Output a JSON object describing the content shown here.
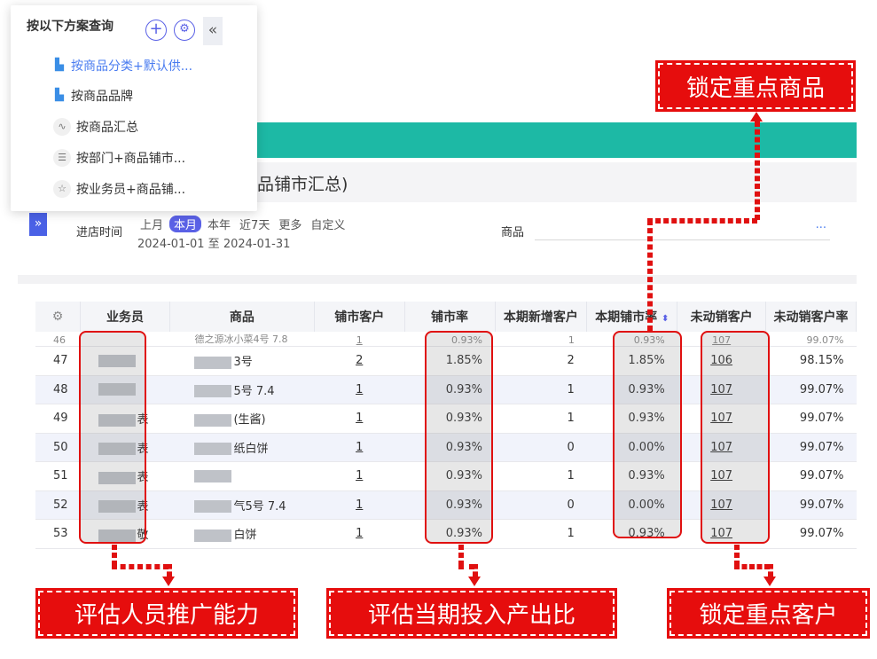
{
  "scheme_panel": {
    "header": "按以下方案查询",
    "items": [
      {
        "label": "按商品分类+默认供...",
        "icon": "bar-chart-icon",
        "active": true
      },
      {
        "label": "按商品品牌",
        "icon": "bar-chart-icon",
        "active": false
      },
      {
        "label": "按商品汇总",
        "icon": "trend-chart-icon",
        "active": false
      },
      {
        "label": "按部门+商品铺市...",
        "icon": "list-icon",
        "active": false
      },
      {
        "label": "按业务员+商品铺...",
        "icon": "star-icon",
        "active": false
      }
    ]
  },
  "page_title_fragment": "品铺市汇总)",
  "filter": {
    "label": "进店时间",
    "periods": [
      "上月",
      "本月",
      "本年",
      "近7天",
      "更多",
      "自定义"
    ],
    "active_period": "本月",
    "date_range": "2024-01-01 至 2024-01-31",
    "goods_label": "商品",
    "goods_more": "..."
  },
  "table": {
    "headers": [
      "业务员",
      "商品",
      "铺市客户",
      "铺市率",
      "本期新增客户",
      "本期铺市率",
      "未动销客户",
      "未动销客户率"
    ],
    "partial_row": {
      "seq": "46",
      "goods": "德之源冰小菜4号 7.8",
      "coverage_customers": "1",
      "coverage_rate": "0.93%",
      "new_customers": "1",
      "period_rate": "0.93%",
      "unsold_customers": "107",
      "unsold_rate": "99.07%"
    },
    "rows": [
      {
        "seq": "47",
        "staff": "",
        "goods": "3号",
        "coverage_customers": "2",
        "coverage_rate": "1.85%",
        "new_customers": "2",
        "period_rate": "1.85%",
        "unsold_customers": "106",
        "unsold_rate": "98.15%"
      },
      {
        "seq": "48",
        "staff": "",
        "goods": "5号 7.4",
        "coverage_customers": "1",
        "coverage_rate": "0.93%",
        "new_customers": "1",
        "period_rate": "0.93%",
        "unsold_customers": "107",
        "unsold_rate": "99.07%"
      },
      {
        "seq": "49",
        "staff": "表",
        "goods": "(生酱)",
        "coverage_customers": "1",
        "coverage_rate": "0.93%",
        "new_customers": "1",
        "period_rate": "0.93%",
        "unsold_customers": "107",
        "unsold_rate": "99.07%"
      },
      {
        "seq": "50",
        "staff": "表",
        "goods": "纸白饼",
        "coverage_customers": "1",
        "coverage_rate": "0.93%",
        "new_customers": "0",
        "period_rate": "0.00%",
        "unsold_customers": "107",
        "unsold_rate": "99.07%"
      },
      {
        "seq": "51",
        "staff": "表",
        "goods": "",
        "coverage_customers": "1",
        "coverage_rate": "0.93%",
        "new_customers": "1",
        "period_rate": "0.93%",
        "unsold_customers": "107",
        "unsold_rate": "99.07%"
      },
      {
        "seq": "52",
        "staff": "表",
        "goods": "气5号 7.4",
        "coverage_customers": "1",
        "coverage_rate": "0.93%",
        "new_customers": "0",
        "period_rate": "0.00%",
        "unsold_customers": "107",
        "unsold_rate": "99.07%"
      },
      {
        "seq": "53",
        "staff": "敬",
        "goods": "白饼",
        "coverage_customers": "1",
        "coverage_rate": "0.93%",
        "new_customers": "1",
        "period_rate": "0.93%",
        "unsold_customers": "107",
        "unsold_rate": "99.07%"
      }
    ]
  },
  "annotations": {
    "lock_key_goods": "锁定重点商品",
    "assess_staff": "评估人员推广能力",
    "assess_roi": "评估当期投入产出比",
    "lock_key_customers": "锁定重点客户"
  },
  "colors": {
    "accent": "#5a61e6",
    "teal": "#1db9a5",
    "annotation_red": "#e60d0d"
  }
}
